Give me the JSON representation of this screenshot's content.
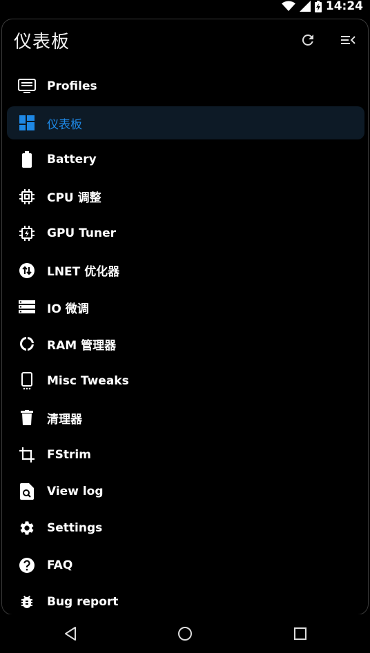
{
  "status": {
    "time": "14:24",
    "icons": [
      "wifi-icon",
      "signal-icon",
      "battery-charging-icon"
    ]
  },
  "header": {
    "title": "仪表板",
    "icons": [
      "refresh-icon",
      "collapse-menu-icon"
    ]
  },
  "menu": {
    "items": [
      {
        "label": "Profiles",
        "icon": "profiles-icon"
      },
      {
        "label": "仪表板",
        "icon": "dashboard-icon",
        "active": true
      },
      {
        "label": "Battery",
        "icon": "battery-icon"
      },
      {
        "label": "CPU 调整",
        "icon": "cpu-icon"
      },
      {
        "label": "GPU Tuner",
        "icon": "gpu-icon"
      },
      {
        "label": "LNET 优化器",
        "icon": "network-icon"
      },
      {
        "label": "IO 微调",
        "icon": "storage-icon"
      },
      {
        "label": "RAM 管理器",
        "icon": "ram-icon"
      },
      {
        "label": "Misc Tweaks",
        "icon": "phone-icon"
      },
      {
        "label": "清理器",
        "icon": "trash-icon"
      },
      {
        "label": "FStrim",
        "icon": "crop-icon"
      },
      {
        "label": "View log",
        "icon": "log-search-icon"
      },
      {
        "label": "Settings",
        "icon": "gear-icon"
      },
      {
        "label": "FAQ",
        "icon": "help-icon"
      },
      {
        "label": "Bug report",
        "icon": "bug-icon"
      }
    ]
  },
  "navbar": {
    "icons": [
      "back-icon",
      "home-icon",
      "recents-icon"
    ]
  },
  "colors": {
    "accent": "#1e88e5",
    "active_bg": "#0d1a26",
    "background": "#000000",
    "text": "#ffffff"
  }
}
